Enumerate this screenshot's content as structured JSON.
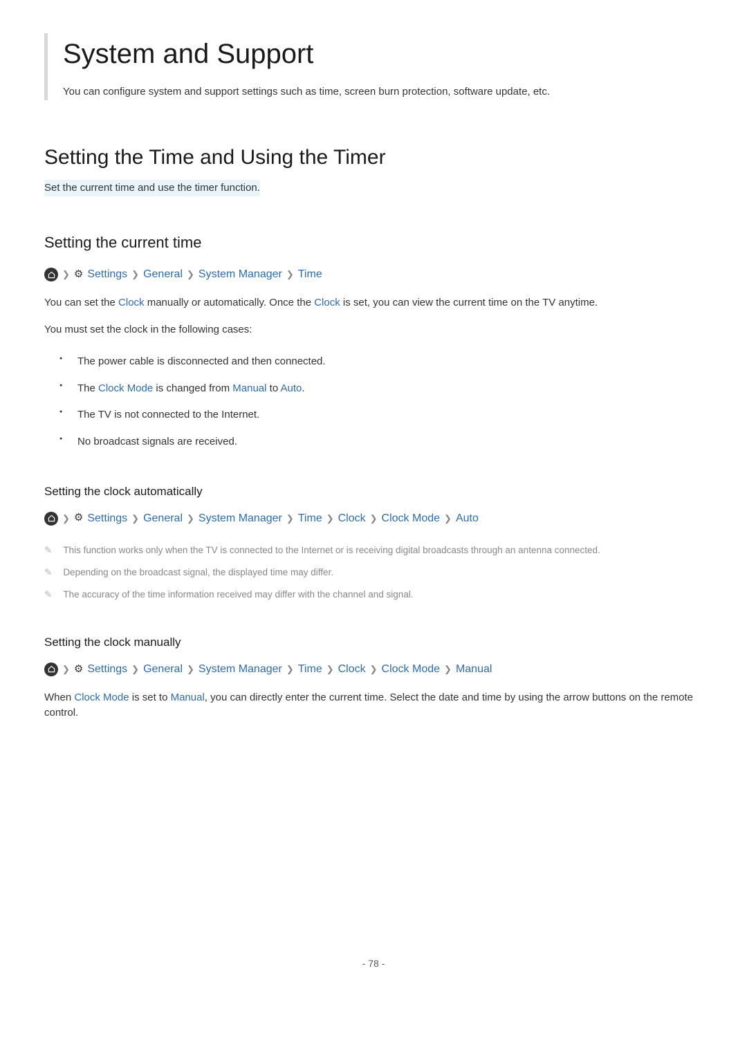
{
  "title": "System and Support",
  "subtitle": "You can configure system and support settings such as time, screen burn protection, software update, etc.",
  "h2": "Setting the Time and Using the Timer",
  "h2_sub": "Set the current time and use the timer function.",
  "h3": "Setting the current time",
  "bc1": {
    "settings": "Settings",
    "general": "General",
    "sysmgr": "System Manager",
    "time": "Time"
  },
  "p1a": "You can set the ",
  "p1b": "Clock",
  "p1c": " manually or automatically. Once the ",
  "p1d": "Clock",
  "p1e": " is set, you can view the current time on the TV anytime.",
  "p2": "You must set the clock in the following cases:",
  "li1": "The power cable is disconnected and then connected.",
  "li2a": "The ",
  "li2b": "Clock Mode",
  "li2c": " is changed from ",
  "li2d": "Manual",
  "li2e": " to ",
  "li2f": "Auto",
  "li2g": ".",
  "li3": "The TV is not connected to the Internet.",
  "li4": "No broadcast signals are received.",
  "h4a": "Setting the clock automatically",
  "bc2": {
    "settings": "Settings",
    "general": "General",
    "sysmgr": "System Manager",
    "time": "Time",
    "clock": "Clock",
    "clockmode": "Clock Mode",
    "auto": "Auto"
  },
  "note1": "This function works only when the TV is connected to the Internet or is receiving digital broadcasts through an antenna connected.",
  "note2": "Depending on the broadcast signal, the displayed time may differ.",
  "note3": "The accuracy of the time information received may differ with the channel and signal.",
  "h4b": "Setting the clock manually",
  "bc3": {
    "settings": "Settings",
    "general": "General",
    "sysmgr": "System Manager",
    "time": "Time",
    "clock": "Clock",
    "clockmode": "Clock Mode",
    "manual": "Manual"
  },
  "p3a": "When ",
  "p3b": "Clock Mode",
  "p3c": " is set to ",
  "p3d": "Manual",
  "p3e": ", you can directly enter the current time. Select the date and time by using the arrow buttons on the remote control.",
  "pagenum": "- 78 -"
}
